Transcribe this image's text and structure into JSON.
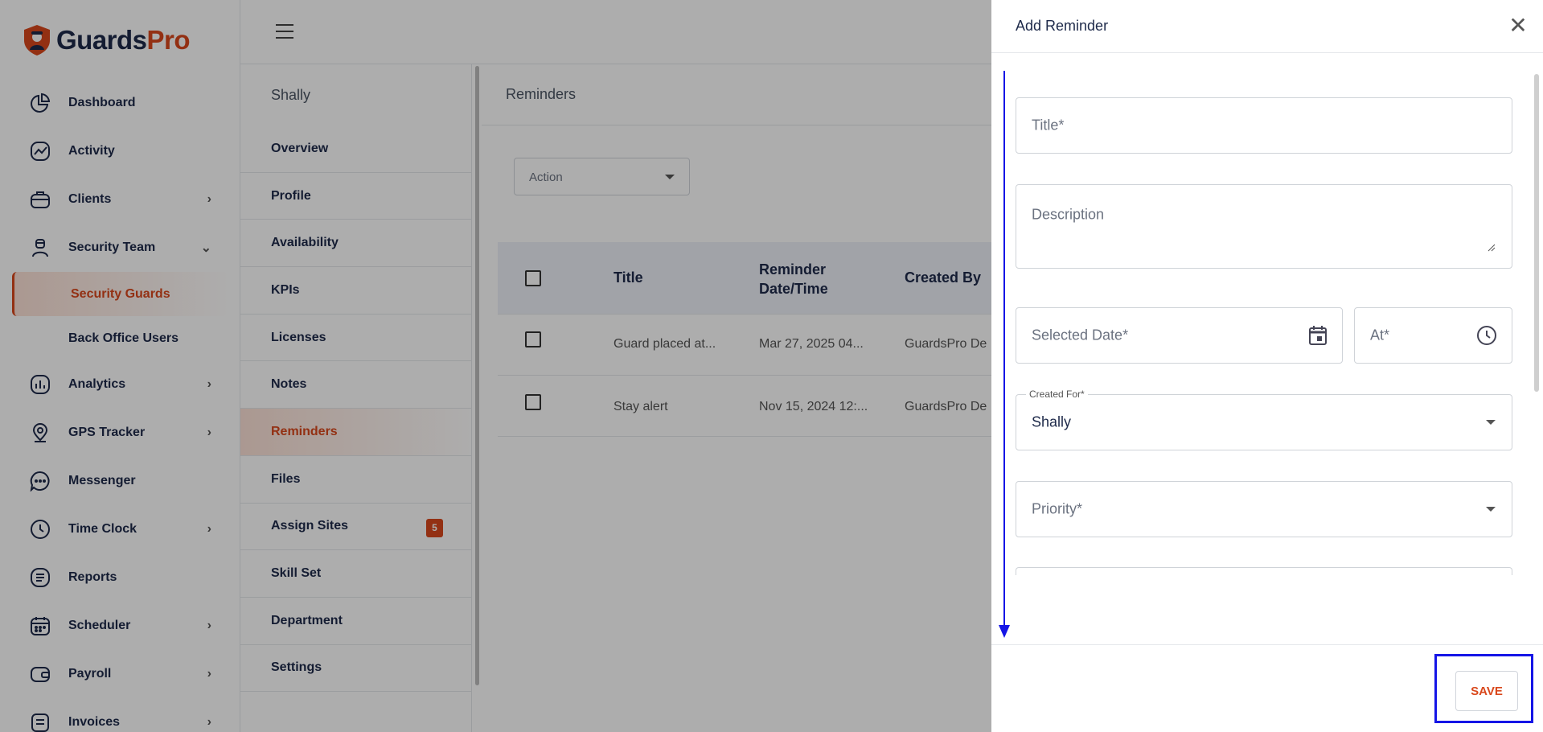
{
  "brand": {
    "part1": "Guards",
    "part2": "Pro"
  },
  "sidebar": {
    "items": [
      {
        "label": "Dashboard",
        "icon": "pie-chart-icon",
        "chevron": ""
      },
      {
        "label": "Activity",
        "icon": "activity-chart-icon",
        "chevron": ""
      },
      {
        "label": "Clients",
        "icon": "briefcase-icon",
        "chevron": "›"
      },
      {
        "label": "Security Team",
        "icon": "guard-icon",
        "chevron": "⌄"
      }
    ],
    "sub_items": [
      {
        "label": "Security Guards"
      },
      {
        "label": "Back Office Users"
      }
    ],
    "items2": [
      {
        "label": "Analytics",
        "icon": "analytics-icon",
        "chevron": "›"
      },
      {
        "label": "GPS Tracker",
        "icon": "location-pin-icon",
        "chevron": "›"
      },
      {
        "label": "Messenger",
        "icon": "chat-bubble-icon",
        "chevron": ""
      },
      {
        "label": "Time Clock",
        "icon": "clock-icon",
        "chevron": "›"
      },
      {
        "label": "Reports",
        "icon": "report-list-icon",
        "chevron": ""
      },
      {
        "label": "Scheduler",
        "icon": "calendar-icon",
        "chevron": "›"
      },
      {
        "label": "Payroll",
        "icon": "wallet-icon",
        "chevron": "›"
      },
      {
        "label": "Invoices",
        "icon": "invoice-icon",
        "chevron": "›"
      }
    ]
  },
  "submenu": {
    "header": "Shally",
    "items": [
      "Overview",
      "Profile",
      "Availability",
      "KPIs",
      "Licenses",
      "Notes",
      "Reminders",
      "Files",
      "Assign Sites",
      "Skill Set",
      "Department",
      "Settings"
    ],
    "assign_sites_badge": "5"
  },
  "main": {
    "title": "Reminders",
    "action_placeholder": "Action",
    "columns": [
      "Title",
      "Reminder\nDate/Time",
      "Created By"
    ],
    "rows": [
      {
        "title": "Guard placed at...",
        "datetime": "Mar 27, 2025 04...",
        "created_by": "GuardsPro De"
      },
      {
        "title": "Stay alert",
        "datetime": "Nov 15, 2024 12:...",
        "created_by": "GuardsPro De"
      }
    ]
  },
  "drawer": {
    "title": "Add Reminder",
    "title_placeholder": "Title*",
    "description_placeholder": "Description",
    "date_placeholder": "Selected Date*",
    "time_placeholder": "At*",
    "created_for_label": "Created For*",
    "created_for_value": "Shally",
    "priority_placeholder": "Priority*",
    "save_label": "SAVE"
  },
  "colors": {
    "accent": "#d9481c",
    "brand_dark": "#1e2a4a",
    "annotation": "#1515e6"
  }
}
